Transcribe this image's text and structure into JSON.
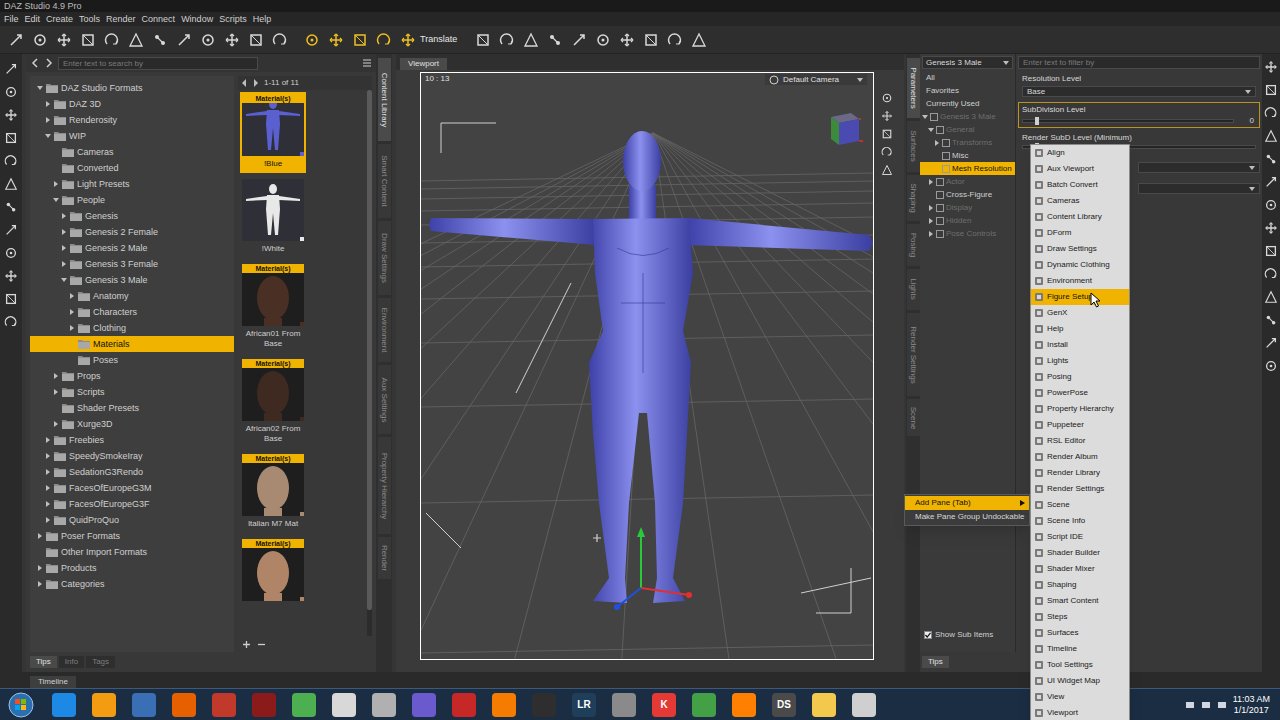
{
  "window": {
    "title": "DAZ Studio 4.9 Pro"
  },
  "menu": [
    "File",
    "Edit",
    "Create",
    "Tools",
    "Render",
    "Connect",
    "Window",
    "Scripts",
    "Help"
  ],
  "toolbar": {
    "tool_label": "Translate",
    "tool_active": true
  },
  "content_library": {
    "search_placeholder": "Enter text to search by",
    "page_info": "1-11 of 11",
    "tree": [
      {
        "label": "DAZ Studio Formats",
        "depth": 0,
        "has_children": true,
        "expanded": true,
        "selected": false
      },
      {
        "label": "DAZ 3D",
        "depth": 1,
        "has_children": true,
        "expanded": false,
        "selected": false
      },
      {
        "label": "Renderosity",
        "depth": 1,
        "has_children": true,
        "expanded": false,
        "selected": false
      },
      {
        "label": "WIP",
        "depth": 1,
        "has_children": true,
        "expanded": true,
        "selected": false
      },
      {
        "label": "Cameras",
        "depth": 2,
        "has_children": false,
        "expanded": false,
        "selected": false
      },
      {
        "label": "Converted",
        "depth": 2,
        "has_children": false,
        "expanded": false,
        "selected": false
      },
      {
        "label": "Light Presets",
        "depth": 2,
        "has_children": true,
        "expanded": false,
        "selected": false
      },
      {
        "label": "People",
        "depth": 2,
        "has_children": true,
        "expanded": true,
        "selected": false
      },
      {
        "label": "Genesis",
        "depth": 3,
        "has_children": true,
        "expanded": false,
        "selected": false
      },
      {
        "label": "Genesis 2 Female",
        "depth": 3,
        "has_children": true,
        "expanded": false,
        "selected": false
      },
      {
        "label": "Genesis 2 Male",
        "depth": 3,
        "has_children": true,
        "expanded": false,
        "selected": false
      },
      {
        "label": "Genesis 3 Female",
        "depth": 3,
        "has_children": true,
        "expanded": false,
        "selected": false
      },
      {
        "label": "Genesis 3 Male",
        "depth": 3,
        "has_children": true,
        "expanded": true,
        "selected": false
      },
      {
        "label": "Anatomy",
        "depth": 4,
        "has_children": true,
        "expanded": false,
        "selected": false
      },
      {
        "label": "Characters",
        "depth": 4,
        "has_children": true,
        "expanded": false,
        "selected": false
      },
      {
        "label": "Clothing",
        "depth": 4,
        "has_children": true,
        "expanded": false,
        "selected": false
      },
      {
        "label": "Materials",
        "depth": 4,
        "has_children": false,
        "expanded": false,
        "selected": true
      },
      {
        "label": "Poses",
        "depth": 4,
        "has_children": false,
        "expanded": false,
        "selected": false
      },
      {
        "label": "Props",
        "depth": 2,
        "has_children": true,
        "expanded": false,
        "selected": false
      },
      {
        "label": "Scripts",
        "depth": 2,
        "has_children": true,
        "expanded": false,
        "selected": false
      },
      {
        "label": "Shader Presets",
        "depth": 2,
        "has_children": false,
        "expanded": false,
        "selected": false
      },
      {
        "label": "Xurge3D",
        "depth": 2,
        "has_children": true,
        "expanded": false,
        "selected": false
      },
      {
        "label": "Freebies",
        "depth": 1,
        "has_children": true,
        "expanded": false,
        "selected": false
      },
      {
        "label": "SpeedySmokeIray",
        "depth": 1,
        "has_children": true,
        "expanded": false,
        "selected": false
      },
      {
        "label": "SedationG3Rendo",
        "depth": 1,
        "has_children": true,
        "expanded": false,
        "selected": false
      },
      {
        "label": "FacesOfEuropeG3M",
        "depth": 1,
        "has_children": true,
        "expanded": false,
        "selected": false
      },
      {
        "label": "FacesOfEuropeG3F",
        "depth": 1,
        "has_children": true,
        "expanded": false,
        "selected": false
      },
      {
        "label": "QuidProQuo",
        "depth": 1,
        "has_children": true,
        "expanded": false,
        "selected": false
      },
      {
        "label": "Poser Formats",
        "depth": 0,
        "has_children": true,
        "expanded": false,
        "selected": false
      },
      {
        "label": "Other Import Formats",
        "depth": 0,
        "has_children": false,
        "expanded": false,
        "selected": false
      },
      {
        "label": "Products",
        "depth": 0,
        "has_children": true,
        "expanded": false,
        "selected": false
      },
      {
        "label": "Categories",
        "depth": 0,
        "has_children": true,
        "expanded": false,
        "selected": false
      }
    ],
    "thumbnails": [
      {
        "label": "!Blue",
        "badge": "Material(s)",
        "selected": true,
        "kind": "figure",
        "color": "#5a60d0"
      },
      {
        "label": "!White",
        "selected": false,
        "kind": "figure",
        "color": "#e8e8e8"
      },
      {
        "label": "African01 From Base",
        "badge": "Material(s)",
        "selected": false,
        "kind": "face",
        "color": "#4a3024"
      },
      {
        "label": "African02 From Base",
        "badge": "Material(s)",
        "selected": false,
        "kind": "face",
        "color": "#3e2a20"
      },
      {
        "label": "Italian M7 Mat",
        "badge": "Material(s)",
        "selected": false,
        "kind": "face",
        "color": "#a88a72"
      },
      {
        "badge": "Material(s)",
        "selected": false,
        "kind": "face",
        "color": "#b08466"
      }
    ],
    "bottom_tabs": [
      {
        "label": "Tips",
        "selected": true
      },
      {
        "label": "Info",
        "selected": false
      },
      {
        "label": "Tags",
        "selected": false
      }
    ]
  },
  "left_side_tabs": [
    {
      "label": "Content Library",
      "selected": true
    },
    {
      "label": "Smart Content",
      "selected": false
    },
    {
      "label": "Draw Settings",
      "selected": false
    },
    {
      "label": "Environment",
      "selected": false
    },
    {
      "label": "Aux Settings",
      "selected": false
    },
    {
      "label": "Property Hierarchy",
      "selected": false
    },
    {
      "label": "Render",
      "selected": false
    }
  ],
  "viewport": {
    "tab": "Viewport",
    "counter": "10 : 13",
    "camera": "Default Camera"
  },
  "right_side_tabs": [
    {
      "label": "Parameters",
      "selected": true
    },
    {
      "label": "Surfaces",
      "selected": false
    },
    {
      "label": "Shaping",
      "selected": false
    },
    {
      "label": "Posing",
      "selected": false
    },
    {
      "label": "Lights",
      "selected": false
    },
    {
      "label": "Render Settings",
      "selected": false
    },
    {
      "label": "Scene",
      "selected": false
    }
  ],
  "parameters": {
    "node": "Genesis 3 Male",
    "filters": [
      "All",
      "Favorites",
      "Currently Used"
    ],
    "tree": [
      {
        "label": "Genesis 3 Male",
        "depth": 0,
        "has_children": true,
        "expanded": true,
        "dimmed": true,
        "selected": false
      },
      {
        "label": "General",
        "depth": 1,
        "has_children": true,
        "expanded": true,
        "dimmed": true,
        "selected": false
      },
      {
        "label": "Transforms",
        "depth": 2,
        "has_children": true,
        "expanded": false,
        "dimmed": true,
        "selected": false
      },
      {
        "label": "Misc",
        "depth": 2,
        "has_children": false,
        "expanded": false,
        "dimmed": false,
        "selected": false
      },
      {
        "label": "Mesh Resolution",
        "depth": 2,
        "has_children": false,
        "expanded": false,
        "dimmed": false,
        "selected": true
      },
      {
        "label": "Actor",
        "depth": 1,
        "has_children": true,
        "expanded": false,
        "dimmed": true,
        "selected": false
      },
      {
        "label": "Cross-Figure",
        "depth": 1,
        "has_children": false,
        "expanded": false,
        "dimmed": false,
        "selected": false
      },
      {
        "label": "Display",
        "depth": 1,
        "has_children": true,
        "expanded": false,
        "dimmed": true,
        "selected": false
      },
      {
        "label": "Hidden",
        "depth": 1,
        "has_children": true,
        "expanded": false,
        "dimmed": true,
        "selected": false
      },
      {
        "label": "Pose Controls",
        "depth": 1,
        "has_children": true,
        "expanded": false,
        "dimmed": true,
        "selected": false
      }
    ],
    "show_sub_items": {
      "label": "Show Sub Items",
      "checked": true
    },
    "bottom_tab": "Tips",
    "search_placeholder": "Enter text to filter by",
    "properties": [
      {
        "kind": "dropdown",
        "label": "Resolution Level",
        "value": "Base",
        "selected": false
      },
      {
        "kind": "slider",
        "label": "SubDivision Level",
        "value": "0",
        "level": 0,
        "selected": true
      },
      {
        "kind": "slider",
        "label": "Render SubD Level (Minimum)",
        "level": 0,
        "selected": false
      }
    ]
  },
  "context_menu": [
    {
      "label": "Add Pane (Tab)",
      "selected": true,
      "submenu": true
    },
    {
      "label": "Make Pane Group Undockable",
      "selected": false,
      "submenu": false
    }
  ],
  "submenu": [
    {
      "label": "Align",
      "selected": false
    },
    {
      "label": "Aux Viewport",
      "selected": false
    },
    {
      "label": "Batch Convert",
      "selected": false
    },
    {
      "label": "Cameras",
      "selected": false
    },
    {
      "label": "Content Library",
      "selected": false
    },
    {
      "label": "DForm",
      "selected": false
    },
    {
      "label": "Draw Settings",
      "selected": false
    },
    {
      "label": "Dynamic Clothing",
      "selected": false
    },
    {
      "label": "Environment",
      "selected": false
    },
    {
      "label": "Figure Setup",
      "selected": true
    },
    {
      "label": "GenX",
      "selected": false
    },
    {
      "label": "Help",
      "selected": false
    },
    {
      "label": "Install",
      "selected": false
    },
    {
      "label": "Lights",
      "selected": false
    },
    {
      "label": "Posing",
      "selected": false
    },
    {
      "label": "PowerPose",
      "selected": false
    },
    {
      "label": "Property Hierarchy",
      "selected": false
    },
    {
      "label": "Puppeteer",
      "selected": false
    },
    {
      "label": "RSL Editor",
      "selected": false
    },
    {
      "label": "Render Album",
      "selected": false
    },
    {
      "label": "Render Library",
      "selected": false
    },
    {
      "label": "Render Settings",
      "selected": false
    },
    {
      "label": "Scene",
      "selected": false
    },
    {
      "label": "Scene Info",
      "selected": false
    },
    {
      "label": "Script IDE",
      "selected": false
    },
    {
      "label": "Shader Builder",
      "selected": false
    },
    {
      "label": "Shader Mixer",
      "selected": false
    },
    {
      "label": "Shaping",
      "selected": false
    },
    {
      "label": "Smart Content",
      "selected": false
    },
    {
      "label": "Steps",
      "selected": false
    },
    {
      "label": "Surfaces",
      "selected": false
    },
    {
      "label": "Timeline",
      "selected": false
    },
    {
      "label": "Tool Settings",
      "selected": false
    },
    {
      "label": "UI Widget Map",
      "selected": false
    },
    {
      "label": "View",
      "selected": false
    },
    {
      "label": "Viewport",
      "selected": false
    }
  ],
  "timeline": {
    "label": "Timeline"
  },
  "taskbar": {
    "apps": [
      {
        "color": "#1e88e5"
      },
      {
        "color": "#f39c12"
      },
      {
        "color": "#3b6fb5"
      },
      {
        "color": "#e66000"
      },
      {
        "color": "#c0392b"
      },
      {
        "color": "#8b1a1a"
      },
      {
        "color": "#4caf50"
      },
      {
        "color": "#d8d8d8"
      },
      {
        "color": "#b0b0b0"
      },
      {
        "color": "#6a5acd"
      },
      {
        "color": "#c62828"
      },
      {
        "color": "#f57c00"
      },
      {
        "color": "#2e2e2e"
      },
      {
        "color": "#1f3e5a",
        "glyph": "LR"
      },
      {
        "color": "#8a8a8a"
      },
      {
        "color": "#e53935",
        "glyph": "K"
      },
      {
        "color": "#43a047"
      },
      {
        "color": "#ff7f00"
      },
      {
        "color": "#4a4a4a",
        "glyph": "DS"
      },
      {
        "color": "#f2c94c"
      },
      {
        "color": "#cfcfcf"
      }
    ],
    "time": "11:03 AM",
    "date": "1/1/2017"
  }
}
